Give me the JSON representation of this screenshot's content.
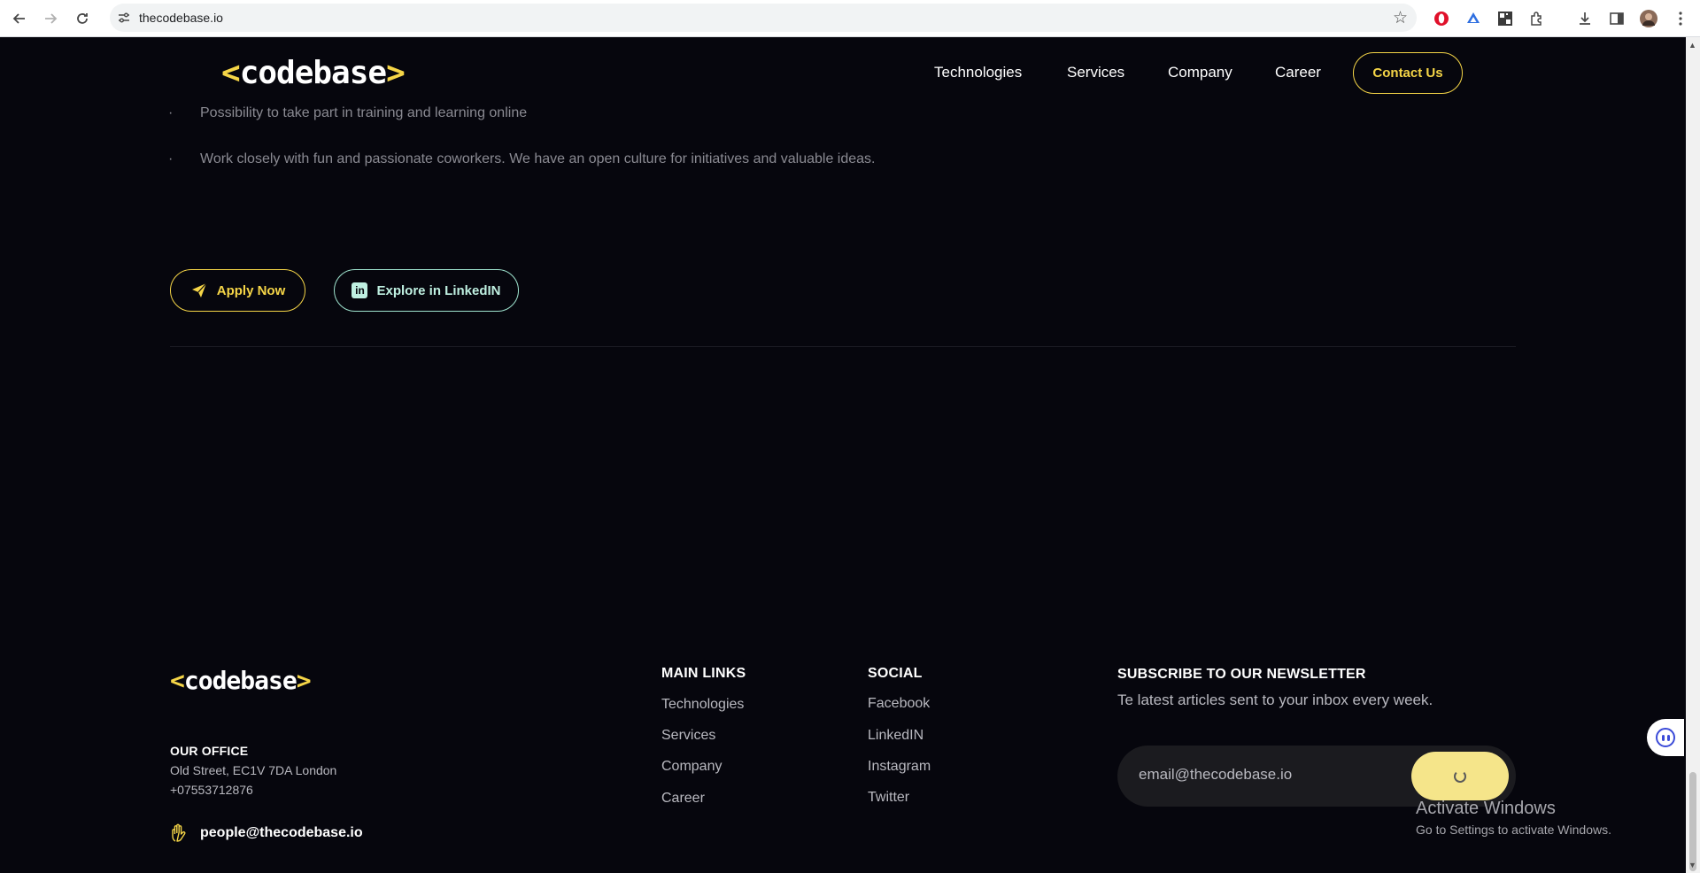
{
  "browser": {
    "url": "thecodebase.io"
  },
  "header": {
    "logo_left": "<",
    "logo_text": "codebase",
    "logo_right": ">",
    "nav": [
      "Technologies",
      "Services",
      "Company",
      "Career"
    ],
    "contact_label": "Contact Us"
  },
  "benefits": [
    {
      "bullet": "·",
      "text": "Possibility to take part in training and learning online"
    },
    {
      "bullet": "·",
      "text": "Work closely with fun and passionate coworkers. We have an open culture for initiatives and valuable ideas."
    }
  ],
  "actions": {
    "apply_label": "Apply Now",
    "linkedin_label": "Explore in LinkedIN",
    "linkedin_icon_text": "in"
  },
  "footer": {
    "office_heading": "OUR OFFICE",
    "address": "Old Street, EC1V 7DA London",
    "phone": "+07553712876",
    "email": "people@thecodebase.io",
    "main_links_heading": "MAIN LINKS",
    "main_links": [
      "Technologies",
      "Services",
      "Company",
      "Career"
    ],
    "social_heading": "SOCIAL",
    "social_links": [
      "Facebook",
      "LinkedIN",
      "Instagram",
      "Twitter"
    ],
    "newsletter_heading": "SUBSCRIBE TO OUR NEWSLETTER",
    "newsletter_sub": "Te latest articles sent to your inbox every week.",
    "newsletter_placeholder": "email@thecodebase.io"
  },
  "watermark": {
    "title": "Activate Windows",
    "subtitle": "Go to Settings to activate Windows."
  },
  "colors": {
    "background": "#06060d",
    "accent": "#f5d547",
    "linkedin_accent": "#9fe4cf"
  }
}
